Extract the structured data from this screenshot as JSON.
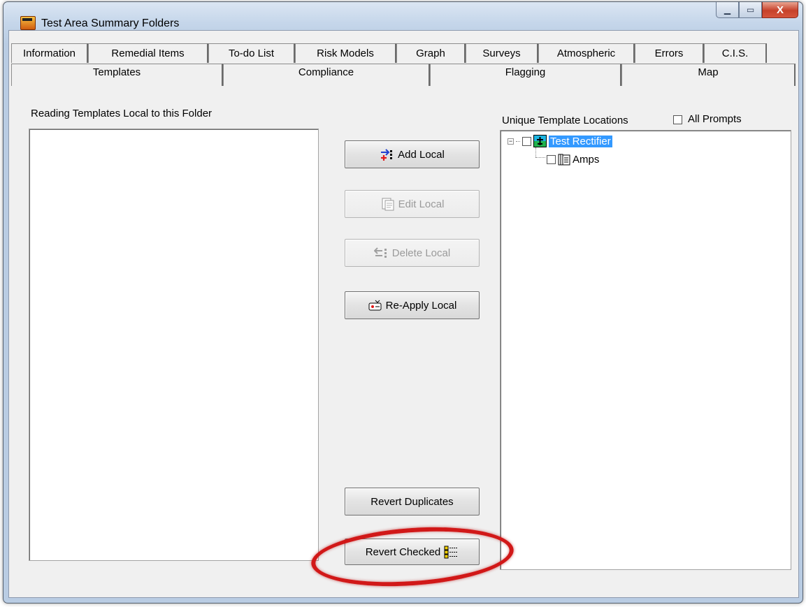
{
  "window": {
    "title": "Test Area Summary Folders",
    "caption_buttons": {
      "minimize": "▁",
      "maximize": "▭",
      "close": "X"
    }
  },
  "tabs": {
    "row1": [
      "Information",
      "Remedial Items",
      "To-do List",
      "Risk Models",
      "Graph",
      "Surveys",
      "Atmospheric",
      "Errors",
      "C.I.S."
    ],
    "row2": [
      "Templates",
      "Compliance",
      "Flagging",
      "Map"
    ],
    "active": "Templates"
  },
  "left_panel": {
    "label": "Reading Templates Local to this Folder"
  },
  "buttons": {
    "add_local": "Add Local",
    "edit_local": "Edit Local",
    "delete_local": "Delete Local",
    "reapply_local": "Re-Apply Local",
    "revert_duplicates": "Revert Duplicates",
    "revert_checked": "Revert Checked"
  },
  "right_panel": {
    "label": "Unique Template Locations",
    "all_prompts_label": "All Prompts",
    "tree": {
      "root": {
        "label": "Test Rectifier",
        "expander": "−"
      },
      "child": {
        "label": "Amps"
      }
    }
  },
  "colors": {
    "selection": "#3399ff",
    "highlight_ring": "#d11818"
  }
}
